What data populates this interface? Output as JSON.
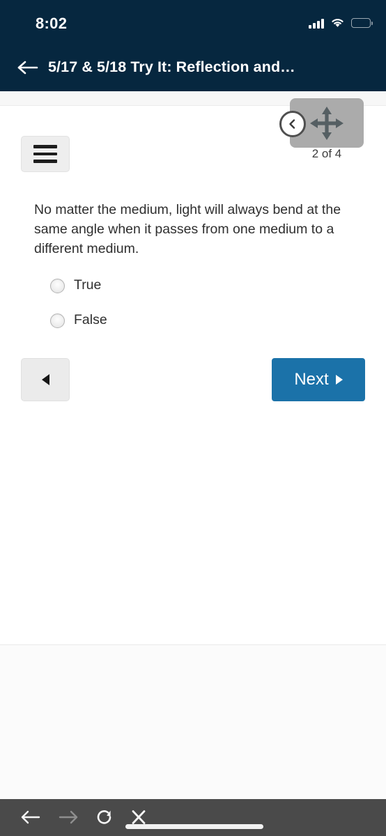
{
  "status_bar": {
    "time": "8:02",
    "signal_icon": "cellular-signal-icon",
    "wifi_icon": "wifi-icon",
    "battery_icon": "battery-icon",
    "battery_level_pct": 50,
    "battery_color": "#f5c518"
  },
  "nav_header": {
    "back_icon": "arrow-left-icon",
    "title": "5/17 & 5/18 Try It: Reflection and…",
    "background_color": "#06273f"
  },
  "toolbar": {
    "menu_icon": "hamburger-menu-icon"
  },
  "move_widget": {
    "move_icon": "move-four-arrows-icon",
    "collapse_icon": "chevron-left-circle-icon",
    "page_count": "2 of 4",
    "panel_color": "#ababab"
  },
  "quiz": {
    "question": "No matter the medium, light will always bend at the same angle when it passes from one medium to a different medium.",
    "choices": [
      {
        "label": "True",
        "selected": false
      },
      {
        "label": "False",
        "selected": false
      }
    ],
    "prev_button": {
      "icon": "triangle-left-icon",
      "label": ""
    },
    "next_button": {
      "label": "Next",
      "icon": "triangle-right-icon",
      "color": "#1b72a9"
    }
  },
  "browser_bar": {
    "background_color": "#4a4a4a",
    "buttons": [
      {
        "name": "browser-back-button",
        "icon": "arrow-left-icon",
        "enabled": true
      },
      {
        "name": "browser-forward-button",
        "icon": "arrow-right-icon",
        "enabled": false
      },
      {
        "name": "browser-reload-button",
        "icon": "reload-icon",
        "enabled": true
      },
      {
        "name": "browser-close-button",
        "icon": "close-x-icon",
        "enabled": true
      }
    ],
    "home_indicator": "home-indicator-bar"
  }
}
